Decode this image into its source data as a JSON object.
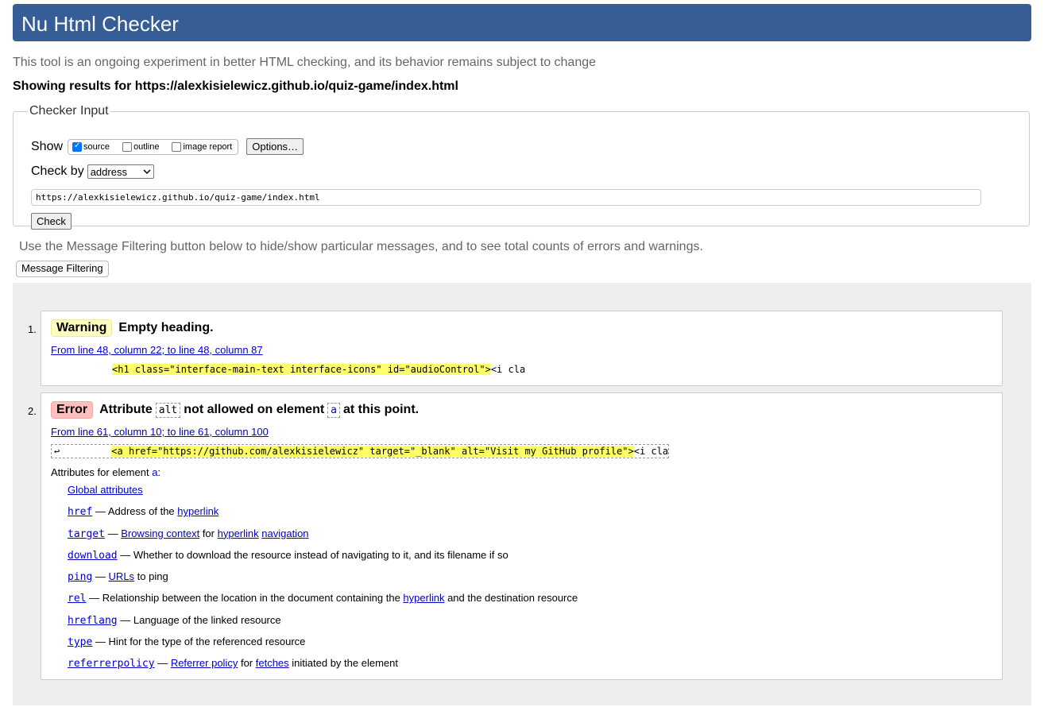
{
  "header": {
    "title": "Nu Html Checker"
  },
  "intro": "This tool is an ongoing experiment in better HTML checking, and its behavior remains subject to change",
  "showing": "Showing results for https://alexkisielewicz.github.io/quiz-game/index.html",
  "checker_input": {
    "legend": "Checker Input",
    "show_label": "Show",
    "options": [
      {
        "label": "source",
        "checked": true
      },
      {
        "label": "outline",
        "checked": false
      },
      {
        "label": "image report",
        "checked": false
      }
    ],
    "options_button": "Options…",
    "check_by_label": "Check by",
    "check_by_value": "address",
    "url_value": "https://alexkisielewicz.github.io/quiz-game/index.html",
    "check_button": "Check"
  },
  "filter_note": "Use the Message Filtering button below to hide/show particular messages, and to see total counts of errors and warnings.",
  "filter_button": "Message Filtering",
  "messages": [
    {
      "num": "1.",
      "type": "Warning",
      "text": "Empty heading.",
      "location": "From line 48, column 22; to line 48, column 87",
      "extract_hl": "<h1 class=\"interface-main-text interface-icons\" id=\"audioControl\">",
      "extract_tail": "<i cla"
    },
    {
      "num": "2.",
      "type": "Error",
      "text_pre": "Attribute",
      "code1": "alt",
      "text_mid": "not allowed on element",
      "code2": "a",
      "text_post": "at this point.",
      "location": "From line 61, column 10; to line 61, column 100",
      "extract_arrow": "↩",
      "extract_hl": "<a href=\"https://github.com/alexkisielewicz\" target=\"_blank\" alt=\"Visit my GitHub profile\">",
      "extract_tail": "<i cla",
      "attrs_title_pre": "Attributes for element",
      "attrs_title_el": "a",
      "attrs_title_post": ":",
      "global_attrs": "Global attributes",
      "attrs": [
        {
          "name": "href",
          "sep": " — ",
          "parts": [
            "Address of the ",
            "hyperlink"
          ]
        },
        {
          "name": "target",
          "sep": " — ",
          "parts": [
            "Browsing context",
            " for ",
            "hyperlink",
            " ",
            "navigation"
          ]
        },
        {
          "name": "download",
          "sep": " — ",
          "parts": [
            "Whether to download the resource instead of navigating to it, and its filename if so"
          ]
        },
        {
          "name": "ping",
          "sep": " — ",
          "parts": [
            "URLs",
            " to ping"
          ]
        },
        {
          "name": "rel",
          "sep": " — ",
          "parts": [
            "Relationship between the location in the document containing the ",
            "hyperlink",
            " and the destination resource"
          ]
        },
        {
          "name": "hreflang",
          "sep": " — ",
          "parts": [
            "Language of the linked resource"
          ]
        },
        {
          "name": "type",
          "sep": " — ",
          "parts": [
            "Hint for the type of the referenced resource"
          ]
        },
        {
          "name": "referrerpolicy",
          "sep": " — ",
          "parts": [
            "Referrer policy",
            " for ",
            "fetches",
            " initiated by the element"
          ]
        }
      ]
    }
  ]
}
